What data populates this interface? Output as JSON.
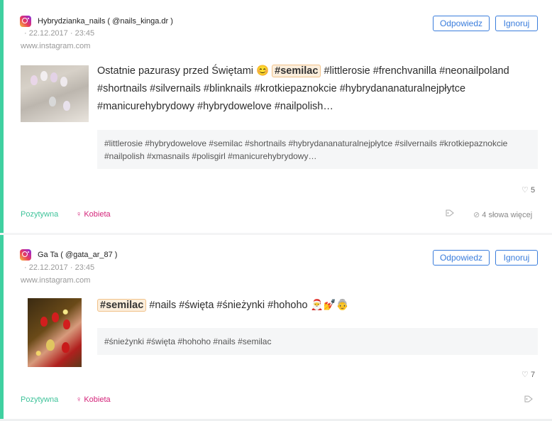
{
  "posts": [
    {
      "author": "Hybrydzianka_nails ( @nails_kinga.dr )",
      "date": "22.12.2017",
      "time": "23:45",
      "source": "www.instagram.com",
      "reply_label": "Odpowiedz",
      "ignore_label": "Ignoruj",
      "text_before": "Ostatnie pazurasy przed Świętami 😊",
      "highlight": "#semilac",
      "text_after": "#littlerosie #frenchvanilla #neonailpoland #shortnails #silvernails #blinknails #krotkiepaznokcie #hybrydananaturalnejpłytce #manicurehybrydowy #hybrydowelove #nailpolish…",
      "tags": "#littlerosie #hybrydowelove #semilac #shortnails #hybrydananaturalnejpłytce #silvernails #krotkiepaznokcie #nailpolish #xmasnails #polisgirl #manicurehybrydowy…",
      "likes": "5",
      "sentiment": "Pozytywna",
      "gender": "Kobieta",
      "more_words": "4 słowa więcej"
    },
    {
      "author": "Ga Ta ( @gata_ar_87 )",
      "date": "22.12.2017",
      "time": "23:45",
      "source": "www.instagram.com",
      "reply_label": "Odpowiedz",
      "ignore_label": "Ignoruj",
      "text_before": "",
      "highlight": "#semilac",
      "text_after": "#nails #święta #śnieżynki #hohoho 🎅💅👵",
      "tags": "#śnieżynki #święta #hohoho #nails #semilac",
      "likes": "7",
      "sentiment": "Pozytywna",
      "gender": "Kobieta"
    }
  ],
  "colors": {
    "accent_green": "#3fd0a0",
    "button_blue": "#3a7ddc",
    "gender_pink": "#d4247a",
    "highlight_bg": "#fbeedc"
  },
  "icons": [
    "instagram-icon",
    "heart-icon",
    "female-icon",
    "tag-icon",
    "check-circle-icon"
  ]
}
